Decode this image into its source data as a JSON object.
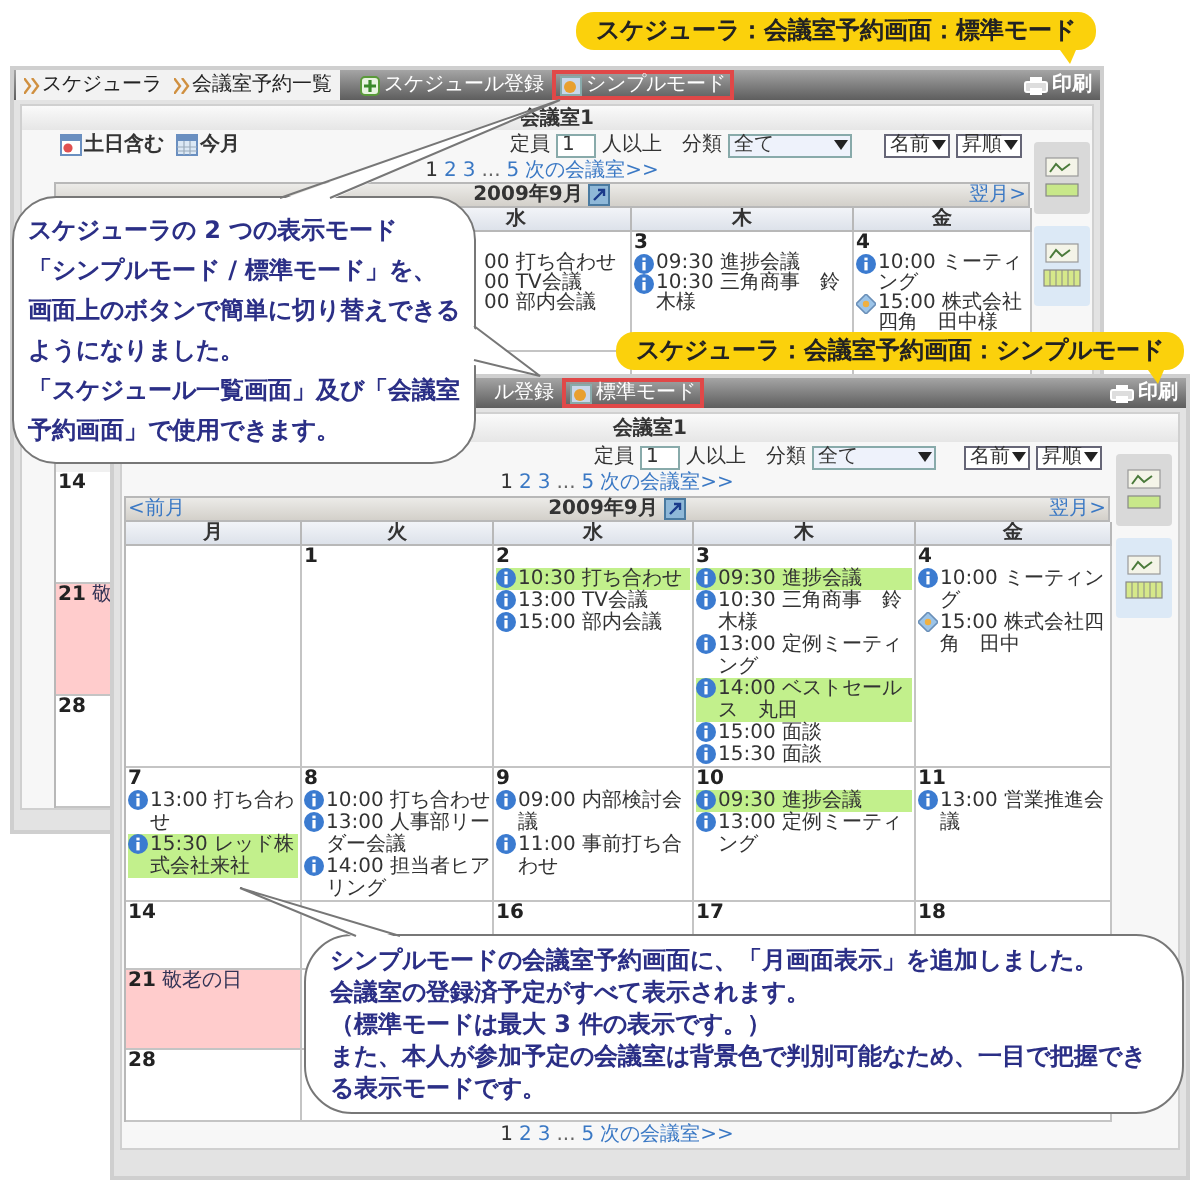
{
  "mode_labels": [
    {
      "text": "スケジューラ：会議室予約画面：標準モード"
    },
    {
      "text": "スケジューラ：会議室予約画面：シンプルモード"
    }
  ],
  "standard_window": {
    "breadcrumbs": [
      "スケジューラ",
      "会議室予約一覧"
    ],
    "toolbar": [
      {
        "label": "スケジュール登録",
        "kind": "add",
        "outlined": false
      },
      {
        "label": "シンプルモード",
        "kind": "mode",
        "outlined": true
      }
    ],
    "print": "印刷",
    "room": "会議室1",
    "toggles": [
      {
        "label": "土日含む",
        "kind": "weekend"
      },
      {
        "label": "今月",
        "kind": "month"
      }
    ],
    "capacity": {
      "label": "定員",
      "value": "1",
      "suffix": "人以上"
    },
    "category": {
      "label": "分類",
      "value": "全て"
    },
    "sort": [
      "名前",
      "昇順"
    ],
    "pager": [
      {
        "label": "1",
        "kind": "current"
      },
      {
        "label": "2",
        "kind": "link"
      },
      {
        "label": "3",
        "kind": "link"
      },
      {
        "label": "...",
        "kind": "gap"
      },
      {
        "label": "5",
        "kind": "link"
      },
      {
        "label": "次の会議室>>",
        "kind": "link"
      }
    ],
    "month": "2009年9月",
    "next_month": "翌月>",
    "weekdays": [
      "水",
      "木",
      "金"
    ],
    "weeks": [
      [
        {
          "kind": "covered"
        },
        {
          "kind": "covered"
        },
        {
          "kind": "day",
          "events": [
            {
              "text": "00 打ち合わせ",
              "kind": "cut",
              "mine": false
            },
            {
              "text": "00 TV会議",
              "kind": "cut",
              "mine": false
            },
            {
              "text": "00 部内会議",
              "kind": "cut",
              "mine": false
            }
          ]
        },
        {
          "kind": "day",
          "day": "3",
          "events": [
            {
              "text": "09:30 進捗会議",
              "kind": "info",
              "mine": false
            },
            {
              "text": "10:30 三角商事　鈴木様",
              "kind": "info",
              "mine": false
            }
          ]
        },
        {
          "kind": "day",
          "day": "4",
          "events": [
            {
              "text": "10:00 ミーティング",
              "kind": "info",
              "mine": false
            },
            {
              "text": "15:00 株式会社四角　田中様",
              "kind": "shared",
              "mine": false
            }
          ]
        }
      ],
      [
        {
          "kind": "covered"
        },
        {
          "kind": "covered"
        },
        {
          "kind": "blank"
        },
        {
          "kind": "blank"
        },
        {
          "kind": "blank"
        }
      ],
      [
        {
          "kind": "day",
          "day": "14"
        }
      ],
      [
        {
          "kind": "day",
          "day": "21",
          "holiday": "敬"
        }
      ],
      [
        {
          "kind": "day",
          "day": "28"
        }
      ]
    ]
  },
  "simple_window": {
    "toolbar": [
      {
        "label": "ル登録",
        "kind": "cut",
        "outlined": false
      },
      {
        "label": "標準モード",
        "kind": "mode",
        "outlined": true
      }
    ],
    "print": "印刷",
    "room": "会議室1",
    "capacity": {
      "label": "定員",
      "value": "1",
      "suffix": "人以上"
    },
    "category": {
      "label": "分類",
      "value": "全て"
    },
    "sort": [
      "名前",
      "昇順"
    ],
    "pager": [
      {
        "label": "1",
        "kind": "current"
      },
      {
        "label": "2",
        "kind": "link"
      },
      {
        "label": "3",
        "kind": "link"
      },
      {
        "label": "...",
        "kind": "gap"
      },
      {
        "label": "5",
        "kind": "link"
      },
      {
        "label": "次の会議室>>",
        "kind": "link"
      }
    ],
    "prev_month": "<前月",
    "month": "2009年9月",
    "next_month": "翌月>",
    "weekdays": [
      "月",
      "火",
      "水",
      "木",
      "金"
    ],
    "weeks": [
      [
        {
          "kind": "blank"
        },
        {
          "kind": "day",
          "day": "1"
        },
        {
          "kind": "day",
          "day": "2",
          "events": [
            {
              "text": "10:30 打ち合わせ",
              "kind": "info",
              "mine": true
            },
            {
              "text": "13:00 TV会議",
              "kind": "info",
              "mine": false
            },
            {
              "text": "15:00 部内会議",
              "kind": "info",
              "mine": false
            }
          ]
        },
        {
          "kind": "day",
          "day": "3",
          "events": [
            {
              "text": "09:30 進捗会議",
              "kind": "info",
              "mine": true
            },
            {
              "text": "10:30 三角商事　鈴木様",
              "kind": "info",
              "mine": false
            },
            {
              "text": "13:00 定例ミーティング",
              "kind": "info",
              "mine": false
            },
            {
              "text": "14:00 ベストセールス　丸田",
              "kind": "info",
              "mine": true
            },
            {
              "text": "15:00 面談",
              "kind": "info",
              "mine": false
            },
            {
              "text": "15:30 面談",
              "kind": "info",
              "mine": false
            }
          ]
        },
        {
          "kind": "day",
          "day": "4",
          "events": [
            {
              "text": "10:00 ミーティング",
              "kind": "info",
              "mine": false
            },
            {
              "text": "15:00 株式会社四角　田中",
              "kind": "shared",
              "mine": false
            }
          ]
        }
      ],
      [
        {
          "kind": "day",
          "day": "7",
          "events": [
            {
              "text": "13:00 打ち合わせ",
              "kind": "info",
              "mine": false
            },
            {
              "text": "15:30 レッド株式会社来社",
              "kind": "info",
              "mine": true
            }
          ]
        },
        {
          "kind": "day",
          "day": "8",
          "events": [
            {
              "text": "10:00 打ち合わせ",
              "kind": "info",
              "mine": false
            },
            {
              "text": "13:00 人事部リーダー会議",
              "kind": "info",
              "mine": false
            },
            {
              "text": "14:00 担当者ヒアリング",
              "kind": "info",
              "mine": false
            }
          ]
        },
        {
          "kind": "day",
          "day": "9",
          "events": [
            {
              "text": "09:00 内部検討会議",
              "kind": "info",
              "mine": false
            },
            {
              "text": "11:00 事前打ち合わせ",
              "kind": "info",
              "mine": false
            }
          ]
        },
        {
          "kind": "day",
          "day": "10",
          "events": [
            {
              "text": "09:30 進捗会議",
              "kind": "info",
              "mine": true
            },
            {
              "text": "13:00 定例ミーティング",
              "kind": "info",
              "mine": false
            }
          ]
        },
        {
          "kind": "day",
          "day": "11",
          "events": [
            {
              "text": "13:00 営業推進会議",
              "kind": "info",
              "mine": false
            }
          ]
        }
      ],
      [
        {
          "kind": "day",
          "day": "14"
        },
        {
          "kind": "blank"
        },
        {
          "kind": "day",
          "day": "16"
        },
        {
          "kind": "day",
          "day": "17"
        },
        {
          "kind": "day",
          "day": "18"
        }
      ],
      [
        {
          "kind": "day",
          "day": "21",
          "holiday": "敬老の日"
        }
      ],
      [
        {
          "kind": "day",
          "day": "28"
        }
      ]
    ],
    "pager_bottom": [
      {
        "label": "1",
        "kind": "current"
      },
      {
        "label": "2",
        "kind": "link"
      },
      {
        "label": "3",
        "kind": "link"
      },
      {
        "label": "...",
        "kind": "gap"
      },
      {
        "label": "5",
        "kind": "link"
      },
      {
        "label": "次の会議室>>",
        "kind": "link"
      }
    ]
  },
  "callouts": [
    {
      "lines": [
        "スケジューラの 2 つの表示モード",
        "「シンプルモード / 標準モード」を、",
        "画面上のボタンで簡単に切り替えできる",
        "ようになりました。",
        "「スケジュール一覧画面」及び「会議室",
        "予約画面」で使用できます。"
      ]
    },
    {
      "lines": [
        "シンプルモードの会議室予約画面に、「月画面表示」を追加しました。",
        "会議室の登録済予定がすべて表示されます。",
        "（標準モードは最大 3 件の表示です。）",
        "また、本人が参加予定の会議室は背景色で判別可能なため、一目で把握でき",
        "る表示モードです。"
      ]
    }
  ]
}
